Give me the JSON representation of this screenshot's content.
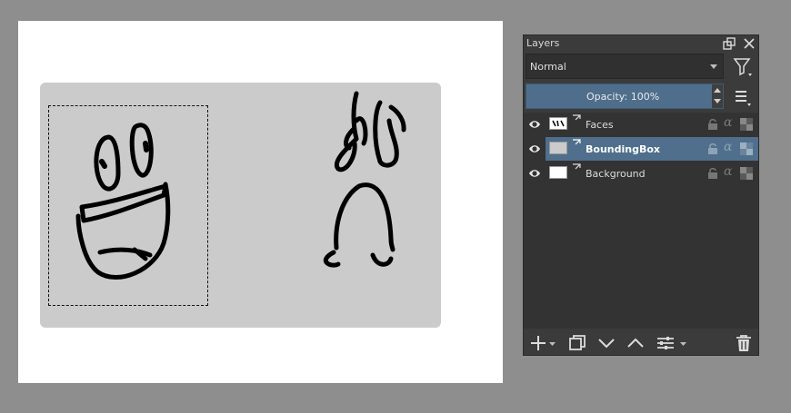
{
  "canvas": {
    "background": "#ffffff",
    "box_color": "#cbcbcb"
  },
  "docker": {
    "title": "Layers",
    "blend_mode": "Normal",
    "opacity_label": "Opacity:  100%",
    "accent": "#4e6e8c",
    "layers": [
      {
        "name": "Faces",
        "selected": false,
        "thumb": "faces"
      },
      {
        "name": "BoundingBox",
        "selected": true,
        "thumb": "gray"
      },
      {
        "name": "Background",
        "selected": false,
        "thumb": "white"
      }
    ],
    "icons": [
      "float-icon",
      "close-icon",
      "filter-icon",
      "menu-icon",
      "eye-icon",
      "lock-icon",
      "alpha-icon",
      "checker-icon",
      "add-icon",
      "duplicate-icon",
      "move-down-icon",
      "move-up-icon",
      "properties-icon",
      "delete-icon"
    ]
  }
}
